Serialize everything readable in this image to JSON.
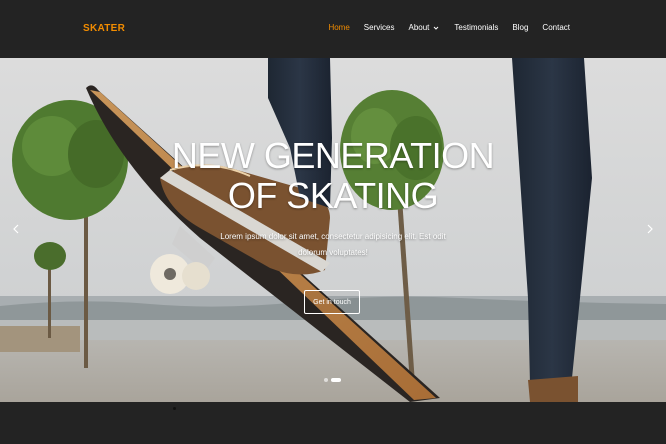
{
  "brand": {
    "logo": "SKATER",
    "accent_color": "#f28c00"
  },
  "nav": {
    "items": [
      {
        "label": "Home",
        "active": true
      },
      {
        "label": "Services"
      },
      {
        "label": "About",
        "dropdown_icon": "chevron-down-icon"
      },
      {
        "label": "Testimonials"
      },
      {
        "label": "Blog"
      },
      {
        "label": "Contact"
      }
    ]
  },
  "hero": {
    "title_line1": "NEW GENERATION",
    "title_line2": "OF SKATING",
    "text": "Lorem ipsum dolor sit amet, consectetur adipisicing elit. Est odit dolorum voluptates!",
    "cta_label": "Get in touch",
    "prev_icon": "chevron-left-icon",
    "next_icon": "chevron-right-icon",
    "slides": 2,
    "active_slide": 2
  }
}
